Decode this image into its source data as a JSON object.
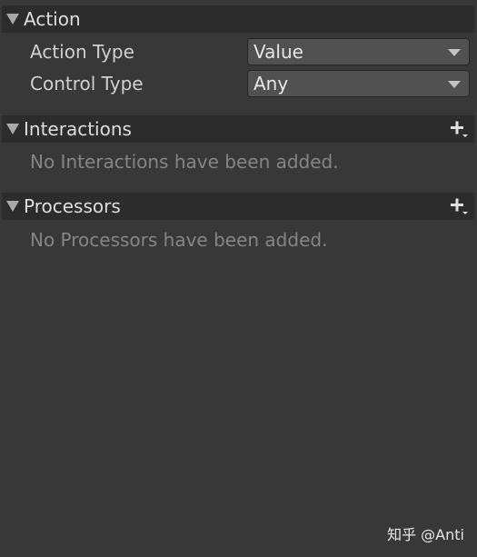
{
  "action": {
    "title": "Action",
    "action_type": {
      "label": "Action Type",
      "value": "Value"
    },
    "control_type": {
      "label": "Control Type",
      "value": "Any"
    }
  },
  "interactions": {
    "title": "Interactions",
    "empty_text": "No Interactions have been added."
  },
  "processors": {
    "title": "Processors",
    "empty_text": "No Processors have been added."
  },
  "watermark": "知乎 @Anti"
}
